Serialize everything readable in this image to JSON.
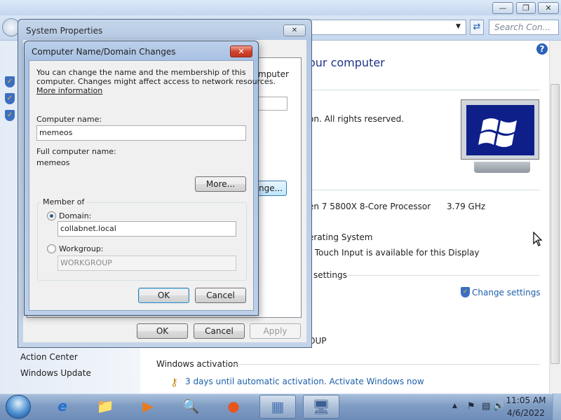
{
  "control_panel": {
    "search_placeholder": "Search Con...",
    "heading": "our computer",
    "text_rights": "on.  All rights reserved.",
    "text_computer": "mputer",
    "processor": "en 7 5800X 8-Core Processor",
    "processor_speed": "3.79 GHz",
    "system_type": "erating System",
    "pen_touch": "r Touch Input is available for this Display",
    "settings_heading": "settings",
    "change_settings": "Change settings",
    "workgroup_peek": "OUP",
    "sidebar": [
      "Action Center",
      "Windows Update"
    ],
    "activation_heading": "Windows activation",
    "activation_link": "3 days until automatic activation. Activate Windows now"
  },
  "system_properties": {
    "title": "System Properties",
    "peek_text": "mputer",
    "peek_button": "nge...",
    "ok": "OK",
    "cancel": "Cancel",
    "apply": "Apply"
  },
  "name_dialog": {
    "title": "Computer Name/Domain Changes",
    "description_line1": "You can change the name and the membership of this",
    "description_line2": "computer. Changes might affect access to network resources.",
    "more_info": "More information",
    "computer_name_label": "Computer name:",
    "computer_name_value": "memeos",
    "full_name_label": "Full computer name:",
    "full_name_value": "memeos",
    "more_button": "More...",
    "member_of_label": "Member of",
    "domain_label": "Domain:",
    "domain_value": "collabnet.local",
    "domain_selected": true,
    "workgroup_label": "Workgroup:",
    "workgroup_value": "WORKGROUP",
    "ok": "OK",
    "cancel": "Cancel"
  },
  "taskbar": {
    "apps": [
      "internet-explorer-icon",
      "file-explorer-icon",
      "media-player-icon",
      "network-icon",
      "firefox-icon",
      "control-panel-icon",
      "system-properties-icon"
    ],
    "time": "11:05 AM",
    "date": "4/6/2022"
  }
}
